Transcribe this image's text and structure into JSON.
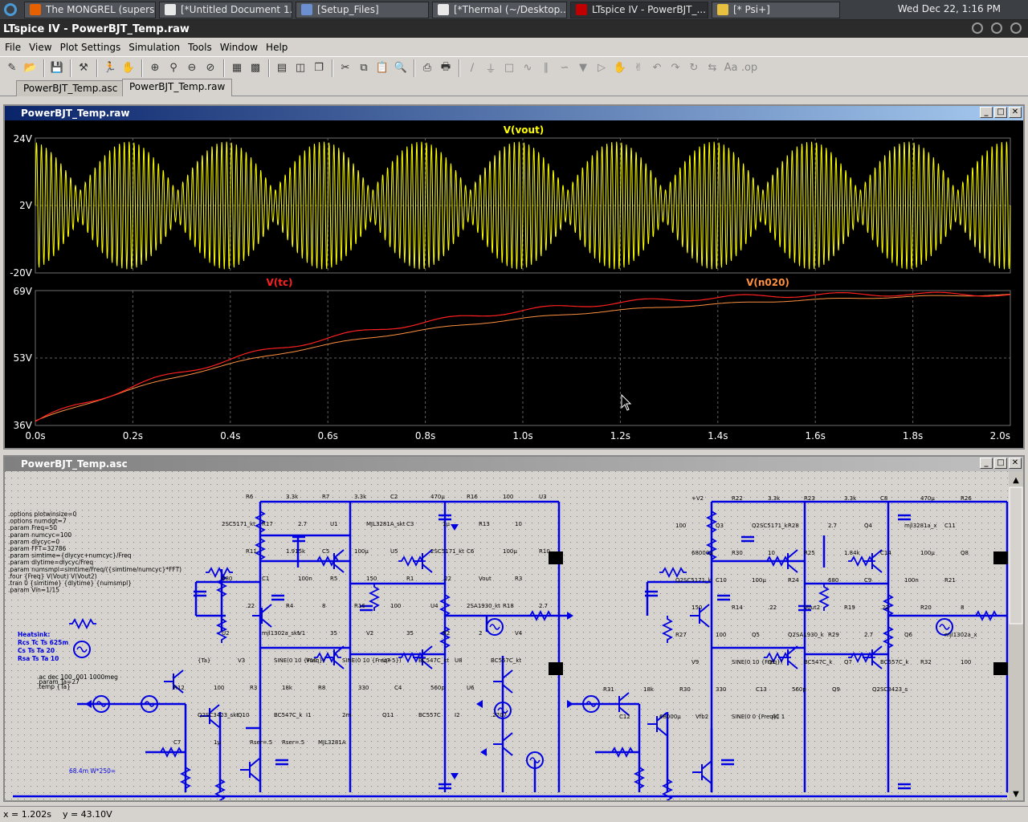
{
  "taskbar": {
    "tasks": [
      {
        "label": "The MONGREL (supers...",
        "icon": "firefox-icon",
        "color": "#e66000"
      },
      {
        "label": "[*Untitled Document 1...",
        "icon": "text-editor-icon",
        "color": "#e8e8e8"
      },
      {
        "label": "[Setup_Files]",
        "icon": "folder-icon",
        "color": "#6b8fd0"
      },
      {
        "label": "[*Thermal (~/Desktop...",
        "icon": "text-editor-icon",
        "color": "#e8e8e8"
      },
      {
        "label": "LTspice IV - PowerBJT_...",
        "icon": "ltspice-icon",
        "color": "#c00000"
      },
      {
        "label": "[* Psi+]",
        "icon": "star-icon",
        "color": "#e8c040"
      }
    ],
    "clock": "Wed Dec 22,  1:16 PM"
  },
  "window": {
    "title": "LTspice IV - PowerBJT_Temp.raw"
  },
  "menu": [
    "File",
    "View",
    "Plot Settings",
    "Simulation",
    "Tools",
    "Window",
    "Help"
  ],
  "doc_tabs": [
    "PowerBJT_Temp.asc",
    "PowerBJT_Temp.raw"
  ],
  "waveform_window": {
    "title": "PowerBJT_Temp.raw",
    "pane1": {
      "trace": "V(vout)",
      "trace_color": "#ffff00",
      "y_ticks": [
        "24V",
        "2V",
        "-20V"
      ]
    },
    "pane2": {
      "traces": [
        "V(tc)",
        "V(n020)"
      ],
      "trace_colors": [
        "#ff2020",
        "#ff9040"
      ],
      "y_ticks": [
        "69V",
        "53V",
        "36V"
      ]
    },
    "x_ticks": [
      "0.0s",
      "0.2s",
      "0.4s",
      "0.6s",
      "0.8s",
      "1.0s",
      "1.2s",
      "1.4s",
      "1.6s",
      "1.8s",
      "2.0s"
    ]
  },
  "schematic_window": {
    "title": "PowerBJT_Temp.asc",
    "directives": [
      ".options plotwinsize=0",
      ".options numdgt=7",
      ".param Freq=50",
      ".param numcyc=100",
      ".param dlycyc=0",
      ".param FFT=32786",
      ".param simtime={dlycyc+numcyc}/Freq",
      ".param dlytime=dlycyc/Freq",
      ".param numsmpl=simtime/Freq/({simtime/numcyc}*FFT)",
      ".four {Freq} V(Vout) V(Vout2)",
      ".tran 0 {simtime} {dlytime} {numsmpl}",
      ".param Vin=1/15"
    ],
    "heatsink": [
      "Heatsink:",
      "Rcs Tc Ts 625m",
      "Cs Ts Ta 20",
      "Rsa Ts Ta 10"
    ],
    "dc_note": [
      ".ac dec 100 .001 1000meg",
      ".param Ta=27",
      ".temp {Ta}"
    ],
    "power_note": "68.4m W*250=",
    "left_labels": [
      "R6",
      "3.3k",
      "R7",
      "3.3k",
      "C2",
      "470µ",
      "R16",
      "100",
      "U3",
      "2SC5171_kt",
      "R17",
      "2.7",
      "U1",
      "MJL3281A_skt",
      "C3",
      "1µ",
      "R13",
      "10",
      "R11",
      "1.915k",
      "C5",
      "100µ",
      "U5",
      "2SC5171_kt",
      "C6",
      "100µ",
      "R10",
      "680",
      "C1",
      "100n",
      "R5",
      "150",
      "R1",
      ".22",
      "Vout",
      "R3",
      ".22",
      "R4",
      "8",
      "R16",
      "100",
      "U4",
      "2SA1930_kt",
      "R18",
      "2.7",
      "U2",
      "mjl1302a_skt",
      "V1",
      "35",
      "V2",
      "35",
      "R2",
      "2",
      "V4",
      "{Ta}",
      "V3",
      "SINE(0 10 {Freq})",
      "V10",
      "SINE(0 10 {Freq+5})",
      "U7",
      "BC547C_kt",
      "U8",
      "BC557C_kt",
      "R12",
      "100",
      "R3",
      "18k",
      "R8",
      "330",
      "C4",
      "560p",
      "U6",
      "Q2SC3423_skt",
      "Q10",
      "BC547C_k",
      "I1",
      "2m",
      "Q11",
      "BC557C",
      "I2",
      ".2707",
      "C7",
      "1µ",
      "Rser=.5",
      "Rser=.5",
      "MJL3281A"
    ],
    "right_labels": [
      "+V2",
      "R22",
      "3.3k",
      "R23",
      "3.3k",
      "C8",
      "470µ",
      "R26",
      "100",
      "Q3",
      "Q2SC5171_k",
      "R28",
      "2.7",
      "Q4",
      "mjl3281a_x",
      "C11",
      "68000µ",
      "R30",
      "10",
      "R25",
      "1.84k",
      "C14",
      "100µ",
      "Q8",
      "Q2SC5171_k",
      "C10",
      "100µ",
      "R24",
      "680",
      "C9",
      "100n",
      "R21",
      "150",
      "R14",
      ".22",
      "Vout2",
      "R19",
      ".22",
      "R20",
      "8",
      "R27",
      "100",
      "Q5",
      "Q2SA1930_k",
      "R29",
      "2.7",
      "Q6",
      "mjl1302a_x",
      "V9",
      "SINE(0 10 {Freq})",
      "Q1",
      "BC547C_k",
      "Q7",
      "BC557C_k",
      "R32",
      "100",
      "R31",
      "18k",
      "R30",
      "330",
      "C13",
      "560p",
      "Q9",
      "Q2SC3423_s",
      "C12",
      "68000µ",
      "Vfb2",
      "SINE(0 0 {Freq})",
      "AC 1"
    ]
  },
  "status": {
    "x": "x = 1.202s",
    "y": "y = 43.10V"
  }
}
